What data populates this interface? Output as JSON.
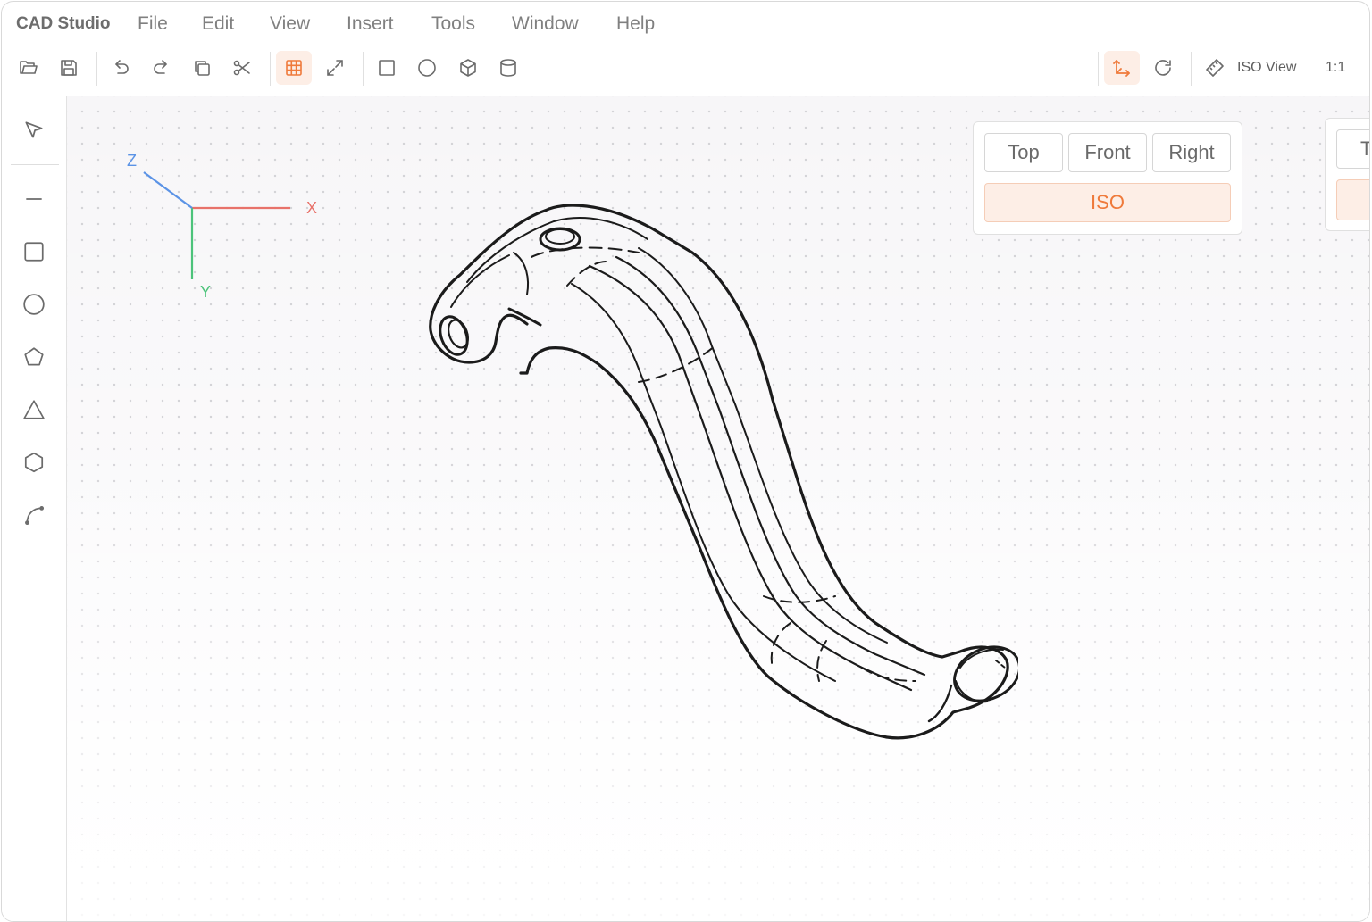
{
  "app": {
    "title": "CAD Studio"
  },
  "menu": [
    "File",
    "Edit",
    "View",
    "Insert",
    "Tools",
    "Window",
    "Help"
  ],
  "toolbar": {
    "view_label": "ISO View",
    "scale_label": "1:1",
    "icons": [
      "open-folder-icon",
      "save-icon",
      "undo-icon",
      "redo-icon",
      "copy-icon",
      "scissors-icon",
      "grid-icon",
      "expand-icon",
      "square-icon",
      "circle-icon",
      "cube-icon",
      "cylinder-icon",
      "axis-icon",
      "rotate-icon",
      "ruler-icon"
    ]
  },
  "tools": [
    "select-arrow-icon",
    "line-icon",
    "rectangle-icon",
    "circle-icon",
    "pentagon-icon",
    "triangle-icon",
    "hexagon-icon",
    "arc-icon"
  ],
  "axes": {
    "x": "X",
    "y": "Y",
    "z": "Z",
    "x_color": "#e8726a",
    "y_color": "#4cc37a",
    "z_color": "#5b93e6"
  },
  "views": {
    "top": "Top",
    "front": "Front",
    "right": "Right",
    "iso": "ISO",
    "partial_top": "To"
  },
  "colors": {
    "accent": "#ef7a3b",
    "accent_bg": "#fdeee6"
  }
}
